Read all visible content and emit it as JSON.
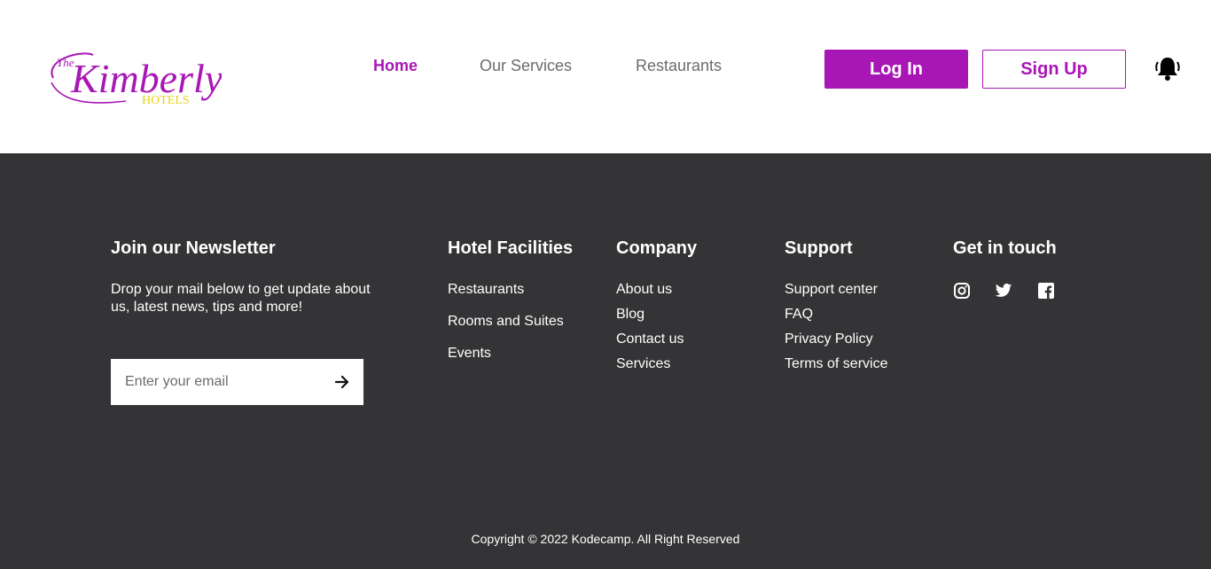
{
  "brand": {
    "logo_the": "The",
    "logo_name": "Kimberly",
    "logo_hotels": "HOTELS",
    "primary_color": "#a817b5",
    "accent_color": "#e8d21a",
    "footer_bg": "#343335"
  },
  "nav": {
    "items": [
      {
        "label": "Home",
        "active": true
      },
      {
        "label": "Our Services",
        "active": false
      },
      {
        "label": "Restaurants",
        "active": false
      }
    ]
  },
  "auth": {
    "login_label": "Log In",
    "signup_label": "Sign Up",
    "notification_icon": "bell-icon"
  },
  "footer": {
    "newsletter": {
      "title": "Join our Newsletter",
      "text": "Drop your mail below to get update about us, latest news, tips and more!",
      "email_placeholder": "Enter your email",
      "submit_icon": "arrow-right-icon"
    },
    "facilities": {
      "title": "Hotel Facilities",
      "links": [
        "Restaurants",
        "Rooms and Suites",
        "Events"
      ]
    },
    "company": {
      "title": "Company",
      "links": [
        "About us",
        "Blog",
        "Contact us",
        "Services"
      ]
    },
    "support": {
      "title": "Support",
      "links": [
        "Support center",
        "FAQ",
        "Privacy Policy",
        "Terms of service"
      ]
    },
    "contact": {
      "title": "Get in touch",
      "icons": [
        "instagram-icon",
        "twitter-icon",
        "facebook-icon"
      ]
    },
    "copyright": "Copyright © 2022 Kodecamp. All Right Reserved"
  }
}
